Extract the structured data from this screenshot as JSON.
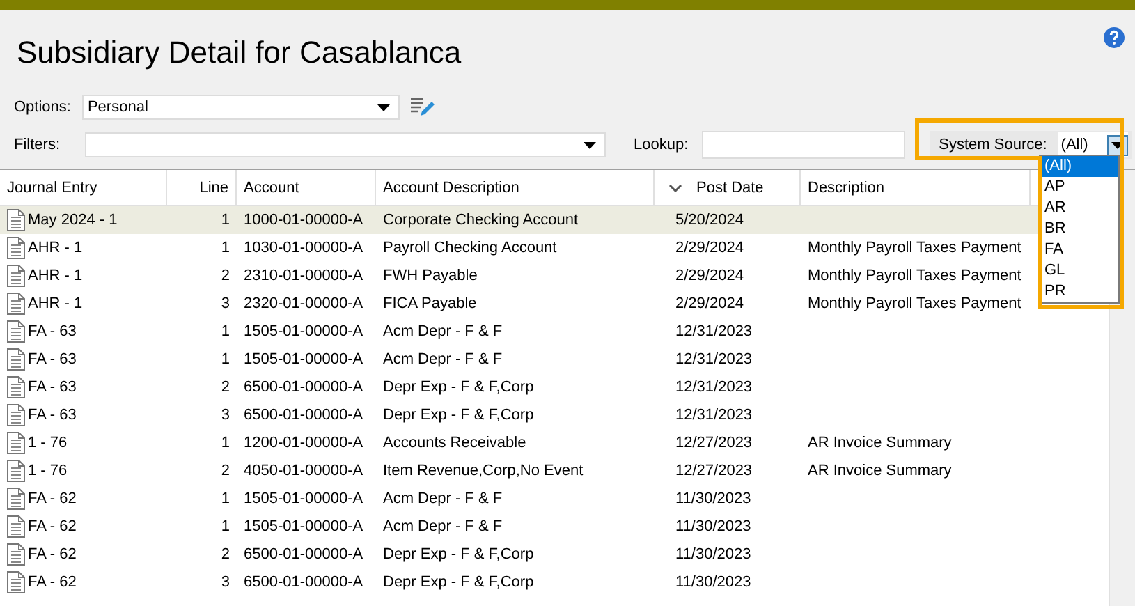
{
  "window": {
    "title": "Subsidiary Detail for Casablanca"
  },
  "options": {
    "label": "Options:",
    "value": "Personal"
  },
  "filters": {
    "label": "Filters:"
  },
  "lookup": {
    "label": "Lookup:"
  },
  "system_source": {
    "label": "System Source:",
    "value": "(All)",
    "expanded": true,
    "highlighted": true,
    "options": [
      {
        "label": "(All)",
        "selected": true
      },
      {
        "label": "AP",
        "selected": false
      },
      {
        "label": "AR",
        "selected": false
      },
      {
        "label": "BR",
        "selected": false
      },
      {
        "label": "FA",
        "selected": false
      },
      {
        "label": "GL",
        "selected": false
      },
      {
        "label": "PR",
        "selected": false
      }
    ]
  },
  "table": {
    "columns": [
      {
        "label": "Journal Entry",
        "sorted": false
      },
      {
        "label": "Line",
        "sorted": false
      },
      {
        "label": "Account",
        "sorted": false
      },
      {
        "label": "Account Description",
        "sorted": false
      },
      {
        "label": "Post Date",
        "sorted": true
      },
      {
        "label": "Description",
        "sorted": false
      }
    ],
    "rows": [
      {
        "journal_entry": "May 2024 - 1",
        "line": "1",
        "account": "1000-01-00000-A",
        "account_description": "Corporate Checking Account",
        "post_date": "5/20/2024",
        "selected": true
      },
      {
        "journal_entry": "AHR - 1",
        "line": "1",
        "account": "1030-01-00000-A",
        "account_description": "Payroll Checking Account",
        "post_date": "2/29/2024",
        "description": "Monthly Payroll Taxes Payment",
        "selected": false
      },
      {
        "journal_entry": "AHR - 1",
        "line": "2",
        "account": "2310-01-00000-A",
        "account_description": "FWH Payable",
        "post_date": "2/29/2024",
        "description": "Monthly Payroll Taxes Payment",
        "selected": false
      },
      {
        "journal_entry": "AHR - 1",
        "line": "3",
        "account": "2320-01-00000-A",
        "account_description": "FICA Payable",
        "post_date": "2/29/2024",
        "description": "Monthly Payroll Taxes Payment",
        "selected": false
      },
      {
        "journal_entry": "FA - 63",
        "line": "1",
        "account": "1505-01-00000-A",
        "account_description": "Acm Depr - F & F",
        "post_date": "12/31/2023",
        "selected": false
      },
      {
        "journal_entry": "FA - 63",
        "line": "1",
        "account": "1505-01-00000-A",
        "account_description": "Acm Depr - F & F",
        "post_date": "12/31/2023",
        "selected": false
      },
      {
        "journal_entry": "FA - 63",
        "line": "2",
        "account": "6500-01-00000-A",
        "account_description": "Depr Exp - F & F,Corp",
        "post_date": "12/31/2023",
        "selected": false
      },
      {
        "journal_entry": "FA - 63",
        "line": "3",
        "account": "6500-01-00000-A",
        "account_description": "Depr Exp - F & F,Corp",
        "post_date": "12/31/2023",
        "selected": false
      },
      {
        "journal_entry": "1 - 76",
        "line": "1",
        "account": "1200-01-00000-A",
        "account_description": "Accounts Receivable",
        "post_date": "12/27/2023",
        "description": "AR Invoice Summary",
        "selected": false
      },
      {
        "journal_entry": "1 - 76",
        "line": "2",
        "account": "4050-01-00000-A",
        "account_description": "Item Revenue,Corp,No Event",
        "post_date": "12/27/2023",
        "description": "AR Invoice Summary",
        "selected": false
      },
      {
        "journal_entry": "FA - 62",
        "line": "1",
        "account": "1505-01-00000-A",
        "account_description": "Acm Depr - F & F",
        "post_date": "11/30/2023",
        "selected": false
      },
      {
        "journal_entry": "FA - 62",
        "line": "1",
        "account": "1505-01-00000-A",
        "account_description": "Acm Depr - F & F",
        "post_date": "11/30/2023",
        "selected": false
      },
      {
        "journal_entry": "FA - 62",
        "line": "2",
        "account": "6500-01-00000-A",
        "account_description": "Depr Exp - F & F,Corp",
        "post_date": "11/30/2023",
        "selected": false
      },
      {
        "journal_entry": "FA - 62",
        "line": "3",
        "account": "6500-01-00000-A",
        "account_description": "Depr Exp - F & F,Corp",
        "post_date": "11/30/2023",
        "selected": false
      }
    ]
  }
}
